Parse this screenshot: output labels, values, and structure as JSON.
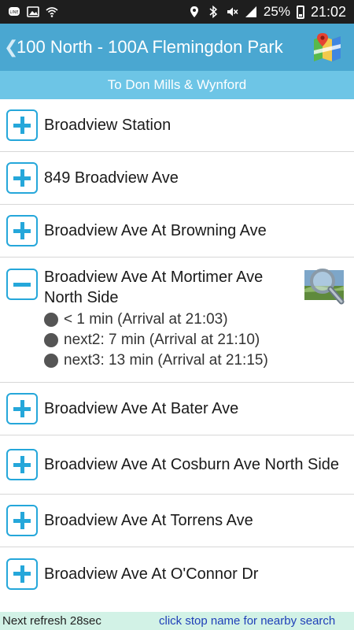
{
  "status_bar": {
    "battery_percent": "25%",
    "time": "21:02"
  },
  "header": {
    "title": "100 North - 100A Flemingdon Park",
    "direction": "To Don Mills & Wynford"
  },
  "stops": [
    {
      "name": "Broadview Station",
      "expanded": false
    },
    {
      "name": "849 Broadview Ave",
      "expanded": false
    },
    {
      "name": "Broadview Ave At Browning Ave",
      "expanded": false
    },
    {
      "name": "Broadview Ave At Mortimer Ave North Side",
      "expanded": true,
      "arrivals": [
        "< 1 min (Arrival at 21:03)",
        "next2: 7 min (Arrival at 21:10)",
        "next3: 13 min (Arrival at 21:15)"
      ]
    },
    {
      "name": "Broadview Ave At Bater Ave",
      "expanded": false
    },
    {
      "name": "Broadview Ave At Cosburn Ave North Side",
      "expanded": false
    },
    {
      "name": "Broadview Ave At Torrens Ave",
      "expanded": false
    },
    {
      "name": "Broadview Ave At O'Connor Dr",
      "expanded": false
    }
  ],
  "footer": {
    "refresh": "Next refresh 28sec",
    "hint": "click stop name for nearby search"
  },
  "colors": {
    "appbar": "#4aa7d1",
    "direction_bar": "#6dc5e6",
    "accent": "#25a7da",
    "footer_bg": "#d2f2e6",
    "hint_text": "#1f3fb8"
  },
  "icons": [
    "line-icon",
    "image-icon",
    "wifi-icon",
    "location-icon",
    "bluetooth-icon",
    "mute-icon",
    "signal-icon",
    "battery-icon",
    "back-chevron-icon",
    "map-icon",
    "plus-icon",
    "minus-icon",
    "dot-icon",
    "magnifier-icon"
  ]
}
